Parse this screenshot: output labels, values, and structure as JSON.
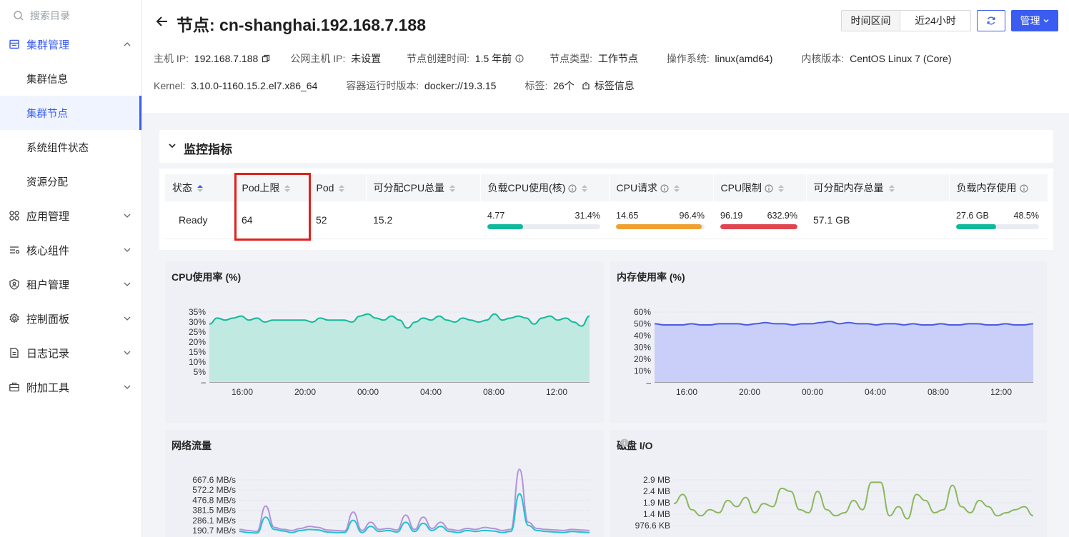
{
  "sidebar": {
    "search_placeholder": "搜索目录",
    "groups": [
      {
        "label": "集群管理",
        "icon": "cluster-icon",
        "expanded": true
      },
      {
        "label": "应用管理",
        "icon": "apps-icon"
      },
      {
        "label": "核心组件",
        "icon": "components-icon"
      },
      {
        "label": "租户管理",
        "icon": "tenant-icon"
      },
      {
        "label": "控制面板",
        "icon": "gear-icon"
      },
      {
        "label": "日志记录",
        "icon": "log-icon"
      },
      {
        "label": "附加工具",
        "icon": "toolbox-icon"
      }
    ],
    "sub_items": [
      {
        "label": "集群信息"
      },
      {
        "label": "集群节点",
        "active": true
      },
      {
        "label": "系统组件状态"
      },
      {
        "label": "资源分配"
      }
    ],
    "accent": "#3a5cf0"
  },
  "header": {
    "title": "节点: cn-shanghai.192.168.7.188",
    "time_range_label": "时间区间",
    "time_range_value": "近24小时",
    "manage_label": "管理",
    "info": {
      "host_ip_label": "主机 IP:",
      "host_ip": "192.168.7.188",
      "public_ip_label": "公网主机 IP:",
      "public_ip": "未设置",
      "created_label": "节点创建时间:",
      "created": "1.5 年前",
      "type_label": "节点类型:",
      "type": "工作节点",
      "os_label": "操作系统:",
      "os": "linux(amd64)",
      "kernel_ver_label": "内核版本:",
      "kernel_ver": "CentOS Linux 7 (Core)",
      "kernel_label": "Kernel:",
      "kernel": "3.10.0-1160.15.2.el7.x86_64",
      "runtime_label": "容器运行时版本:",
      "runtime": "docker://19.3.15",
      "tags_label": "标签:",
      "tags": "26个",
      "tags_link": "标签信息"
    }
  },
  "monitor": {
    "title": "监控指标",
    "columns": [
      "状态",
      "Pod上限",
      "Pod",
      "可分配CPU总量",
      "负载CPU使用(核)",
      "CPU请求",
      "CPU限制",
      "可分配内存总量",
      "负载内存使用"
    ],
    "row": {
      "status": "Ready",
      "pod_limit": "64",
      "pod": "52",
      "alloc_cpu": "15.2",
      "cpu_usage": {
        "value": "4.77",
        "pct": "31.4%",
        "fraction": 0.314,
        "color": "#10b99a"
      },
      "cpu_request": {
        "value": "14.65",
        "pct": "96.4%",
        "fraction": 0.964,
        "color": "#f0a030"
      },
      "cpu_limit": {
        "value": "96.19",
        "pct": "632.9%",
        "fraction": 1.0,
        "color": "#e0454f"
      },
      "alloc_mem": "57.1 GB",
      "mem_usage": {
        "value": "27.6 GB",
        "pct": "48.5%",
        "fraction": 0.485,
        "color": "#10b99a"
      }
    }
  },
  "chart_data": [
    {
      "type": "area",
      "title": "CPU使用率 (%)",
      "yticks": [
        "35%",
        "30%",
        "25%",
        "20%",
        "15%",
        "10%",
        "5%",
        "–"
      ],
      "xticks": [
        "16:00",
        "20:00",
        "00:00",
        "04:00",
        "08:00",
        "12:00"
      ],
      "ylim": [
        0,
        35
      ],
      "color": "#10b99a",
      "fill": "#bfe9e1",
      "series": [
        {
          "values": [
            29,
            32,
            31,
            32,
            33,
            31,
            32,
            30,
            31,
            31,
            31,
            31,
            31,
            30,
            32,
            31,
            31,
            31,
            30,
            33,
            34,
            32,
            31,
            33,
            31,
            27,
            30,
            32,
            31,
            33,
            31,
            30,
            32,
            31,
            30,
            31,
            34,
            31,
            32,
            33,
            32,
            29,
            32,
            33,
            31,
            32,
            30,
            28,
            33
          ]
        }
      ]
    },
    {
      "type": "area",
      "title": "内存使用率 (%)",
      "yticks": [
        "60%",
        "50%",
        "40%",
        "30%",
        "20%",
        "10%",
        "–"
      ],
      "xticks": [
        "16:00",
        "20:00",
        "00:00",
        "04:00",
        "08:00",
        "12:00"
      ],
      "ylim": [
        0,
        60
      ],
      "color": "#4b5be0",
      "fill": "#c9cff8",
      "series": [
        {
          "values": [
            50,
            49,
            49,
            49,
            50,
            49,
            49,
            50,
            50,
            50,
            49,
            50,
            51,
            50,
            50,
            49,
            50,
            50,
            51,
            52,
            50,
            51,
            50,
            50,
            49,
            50,
            50,
            49,
            50,
            49,
            49,
            50,
            49,
            49,
            50,
            50,
            49,
            49,
            50,
            49,
            49,
            50
          ]
        }
      ]
    },
    {
      "type": "line",
      "title": "网络流量",
      "yticks": [
        "667.6 MB/s",
        "572.2 MB/s",
        "476.8 MB/s",
        "381.5 MB/s",
        "286.1 MB/s",
        "190.7 MB/s"
      ],
      "ylim": [
        0,
        700
      ],
      "series": [
        {
          "color": "#b592d8",
          "values": [
            130,
            120,
            110,
            360,
            150,
            130,
            120,
            140,
            160,
            150,
            125,
            120,
            115,
            300,
            120,
            200,
            130,
            140,
            125,
            270,
            130,
            250,
            140,
            200,
            130,
            120,
            140,
            130,
            150,
            140,
            120,
            130,
            720,
            200,
            140,
            130,
            125,
            120,
            130,
            125,
            120
          ]
        },
        {
          "color": "#1bc3d3",
          "values": [
            110,
            100,
            95,
            250,
            130,
            115,
            100,
            120,
            130,
            125,
            105,
            100,
            100,
            220,
            100,
            160,
            110,
            120,
            105,
            200,
            110,
            190,
            120,
            160,
            110,
            100,
            120,
            110,
            120,
            115,
            100,
            110,
            480,
            170,
            120,
            110,
            105,
            100,
            110,
            105,
            100
          ]
        }
      ]
    },
    {
      "type": "line",
      "title": "磁盘 I/O",
      "yticks": [
        "2.9 MB",
        "2.4 MB",
        "1.9 MB",
        "1.4 MB",
        "976.6 KB"
      ],
      "ylim": [
        0,
        3.0
      ],
      "color": "#8cb85c",
      "series": [
        {
          "values": [
            1.8,
            2.1,
            1.6,
            1.4,
            1.6,
            1.5,
            1.9,
            1.7,
            2.0,
            1.5,
            1.8,
            1.7,
            2.3,
            2.2,
            1.6,
            1.5,
            2.2,
            1.6,
            1.4,
            1.5,
            1.9,
            1.6,
            2.5,
            2.5,
            1.4,
            1.7,
            1.3,
            2.1,
            1.9,
            1.5,
            1.6,
            2.4,
            1.7,
            1.5,
            1.9,
            1.7,
            1.4,
            1.5,
            1.6,
            1.7,
            1.4
          ]
        }
      ]
    }
  ]
}
